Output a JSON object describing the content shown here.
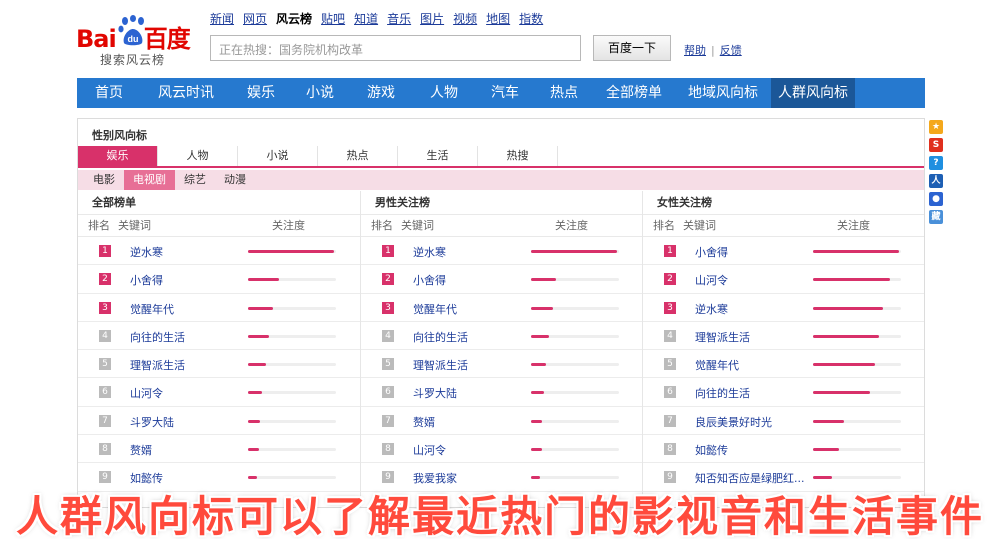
{
  "top_links": [
    "新闻",
    "网页",
    "风云榜",
    "贴吧",
    "知道",
    "音乐",
    "图片",
    "视频",
    "地图",
    "指数"
  ],
  "logo": {
    "brand_left": "Bai",
    "brand_right": "百度",
    "paw_text": "du",
    "subtitle": "搜索风云榜"
  },
  "search": {
    "placeholder": "正在热搜：国务院机构改革",
    "button": "百度一下",
    "help": "帮助",
    "feedback": "反馈"
  },
  "categories": [
    "首页",
    "风云时讯",
    "娱乐",
    "小说",
    "游戏",
    "人物",
    "汽车",
    "热点",
    "全部榜单",
    "地域风向标",
    "人群风向标"
  ],
  "active_category": "人群风向标",
  "panel": {
    "title": "性别风向标",
    "tabs": [
      "娱乐",
      "人物",
      "小说",
      "热点",
      "生活",
      "热搜"
    ],
    "active_tab": "娱乐",
    "subtabs": [
      "电影",
      "电视剧",
      "综艺",
      "动漫"
    ],
    "active_subtab": "电视剧",
    "header": {
      "rank": "排名",
      "keyword": "关键词",
      "attention": "关注度"
    }
  },
  "columns": [
    {
      "title": "全部榜单",
      "rows": [
        {
          "rank": "1",
          "keyword": "逆水寒",
          "level": 0.98
        },
        {
          "rank": "2",
          "keyword": "小舍得",
          "level": 0.35
        },
        {
          "rank": "3",
          "keyword": "觉醒年代",
          "level": 0.28
        },
        {
          "rank": "4",
          "keyword": "向往的生活",
          "level": 0.24
        },
        {
          "rank": "5",
          "keyword": "理智派生活",
          "level": 0.2
        },
        {
          "rank": "6",
          "keyword": "山河令",
          "level": 0.16
        },
        {
          "rank": "7",
          "keyword": "斗罗大陆",
          "level": 0.14
        },
        {
          "rank": "8",
          "keyword": "赘婿",
          "level": 0.12
        },
        {
          "rank": "9",
          "keyword": "如懿传",
          "level": 0.1
        }
      ]
    },
    {
      "title": "男性关注榜",
      "rows": [
        {
          "rank": "1",
          "keyword": "逆水寒",
          "level": 0.98
        },
        {
          "rank": "2",
          "keyword": "小舍得",
          "level": 0.28
        },
        {
          "rank": "3",
          "keyword": "觉醒年代",
          "level": 0.25
        },
        {
          "rank": "4",
          "keyword": "向往的生活",
          "level": 0.2
        },
        {
          "rank": "5",
          "keyword": "理智派生活",
          "level": 0.17
        },
        {
          "rank": "6",
          "keyword": "斗罗大陆",
          "level": 0.15
        },
        {
          "rank": "7",
          "keyword": "赘婿",
          "level": 0.13
        },
        {
          "rank": "8",
          "keyword": "山河令",
          "level": 0.12
        },
        {
          "rank": "9",
          "keyword": "我爱我家",
          "level": 0.1
        }
      ]
    },
    {
      "title": "女性关注榜",
      "rows": [
        {
          "rank": "1",
          "keyword": "小舍得",
          "level": 0.98
        },
        {
          "rank": "2",
          "keyword": "山河令",
          "level": 0.88
        },
        {
          "rank": "3",
          "keyword": "逆水寒",
          "level": 0.8
        },
        {
          "rank": "4",
          "keyword": "理智派生活",
          "level": 0.75
        },
        {
          "rank": "5",
          "keyword": "觉醒年代",
          "level": 0.7
        },
        {
          "rank": "6",
          "keyword": "向往的生活",
          "level": 0.65
        },
        {
          "rank": "7",
          "keyword": "良辰美景好时光",
          "level": 0.35
        },
        {
          "rank": "8",
          "keyword": "如懿传",
          "level": 0.3
        },
        {
          "rank": "9",
          "keyword": "知否知否应是绿肥红...",
          "level": 0.22
        }
      ]
    }
  ],
  "side_icons": [
    {
      "name": "star-icon",
      "color": "#f4a81c"
    },
    {
      "name": "weibo-icon",
      "color": "#e0301e"
    },
    {
      "name": "qzone-icon",
      "color": "#1f8fe0"
    },
    {
      "name": "renren-icon",
      "color": "#1d5fb4"
    },
    {
      "name": "baidu-paw-icon",
      "color": "#2c63d1"
    },
    {
      "name": "bookmark-icon",
      "color": "#4a90d9"
    }
  ],
  "caption": "人群风向标可以了解最近热门的影视音和生活事件",
  "colors": {
    "accent_blue": "#2679cf",
    "accent_pink": "#d8316a",
    "link_blue": "#1c3b99",
    "baidu_red": "#e10601"
  }
}
